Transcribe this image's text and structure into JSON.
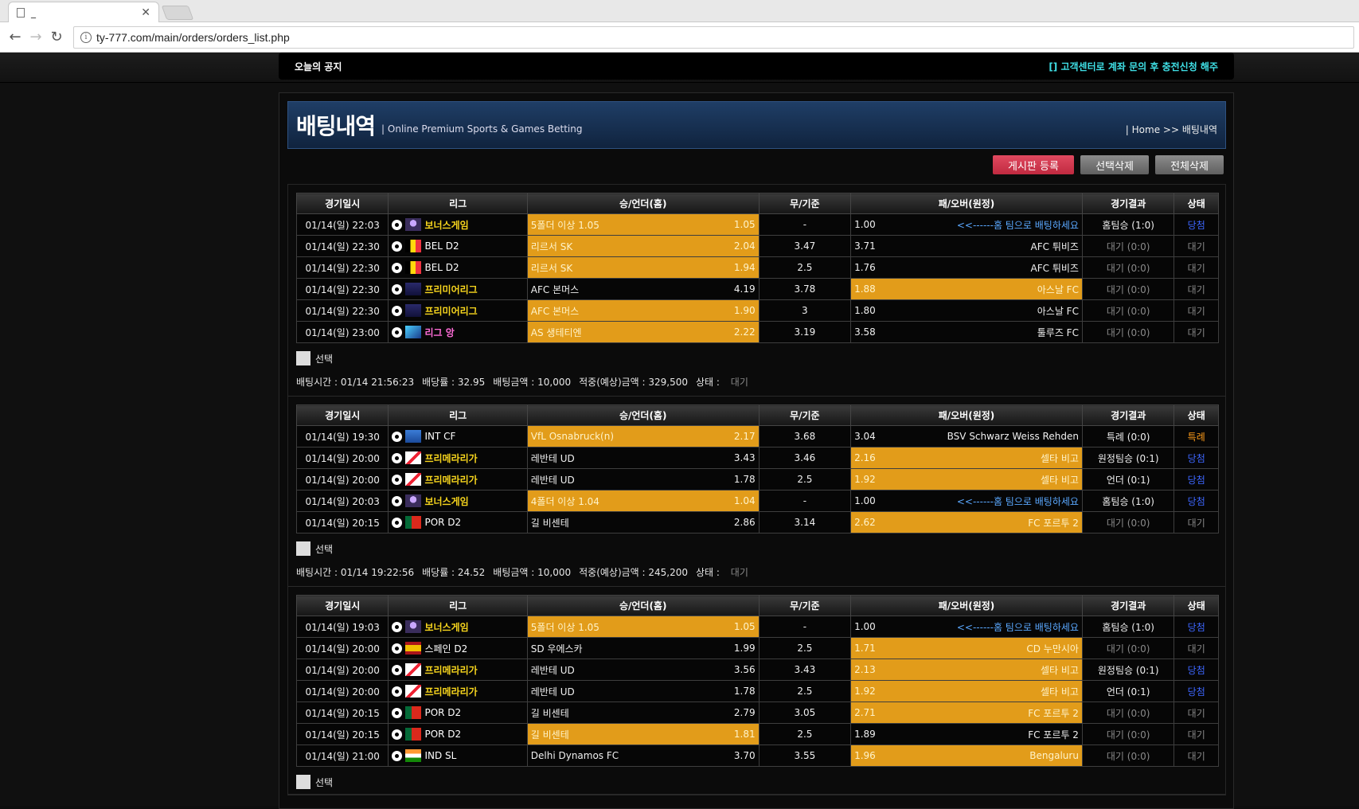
{
  "browser": {
    "tab_title": "_",
    "url": "ty-777.com/main/orders/orders_list.php"
  },
  "notice": {
    "label": "오늘의 공지",
    "text": "[] 고객센터로 계좌 문의 후 충전신청 해주"
  },
  "header": {
    "title": "배팅내역",
    "subtitle": "| Online Premium Sports & Games Betting",
    "breadcrumb": "| Home >> 배팅내역"
  },
  "buttons": {
    "register": "게시판 등록",
    "delete_selected": "선택삭제",
    "delete_all": "전체삭제"
  },
  "columns": [
    "경기일시",
    "리그",
    "승/언더(홈)",
    "무/기준",
    "패/오버(원정)",
    "경기결과",
    "상태"
  ],
  "select_label": "선택",
  "blocks": [
    {
      "rows": [
        {
          "date": "01/14(일) 22:03",
          "league": "보너스게임",
          "lstyle": "yellow",
          "flag": "bonus",
          "home": "5폴더 이상 1.05",
          "hodd": "1.05",
          "draw": "-",
          "aodd": "1.00",
          "away": "<<------홈 팀으로 배팅하세요",
          "awayBlue": true,
          "pick": "home",
          "result": "홈팀승 (1:0)",
          "status": "당첨",
          "sstyle": "blue"
        },
        {
          "date": "01/14(일) 22:30",
          "league": "BEL D2",
          "lstyle": "white",
          "flag": "bel",
          "home": "리르서 SK",
          "hodd": "2.04",
          "draw": "3.47",
          "aodd": "3.71",
          "away": "AFC 튀비즈",
          "pick": "home",
          "result": "대기 (0:0)",
          "status": "대기",
          "sstyle": "gray"
        },
        {
          "date": "01/14(일) 22:30",
          "league": "BEL D2",
          "lstyle": "white",
          "flag": "bel",
          "home": "리르서 SK",
          "hodd": "1.94",
          "draw": "2.5",
          "aodd": "1.76",
          "away": "AFC 튀비즈",
          "pick": "home",
          "result": "대기 (0:0)",
          "status": "대기",
          "sstyle": "gray"
        },
        {
          "date": "01/14(일) 22:30",
          "league": "프리미어리그",
          "lstyle": "yellow",
          "flag": "epl",
          "home": "AFC 본머스",
          "hodd": "4.19",
          "draw": "3.78",
          "aodd": "1.88",
          "away": "아스날 FC",
          "pick": "away",
          "result": "대기 (0:0)",
          "status": "대기",
          "sstyle": "gray"
        },
        {
          "date": "01/14(일) 22:30",
          "league": "프리미어리그",
          "lstyle": "yellow",
          "flag": "epl",
          "home": "AFC 본머스",
          "hodd": "1.90",
          "draw": "3",
          "aodd": "1.80",
          "away": "아스날 FC",
          "pick": "home",
          "result": "대기 (0:0)",
          "status": "대기",
          "sstyle": "gray"
        },
        {
          "date": "01/14(일) 23:00",
          "league": "리그 앙",
          "lstyle": "pink",
          "flag": "l1",
          "home": "AS 생테티엔",
          "hodd": "2.22",
          "draw": "3.19",
          "aodd": "3.58",
          "away": "툴루즈 FC",
          "pick": "home",
          "result": "대기 (0:0)",
          "status": "대기",
          "sstyle": "gray"
        }
      ],
      "summary": {
        "time": "배팅시간 : 01/14 21:56:23",
        "rate": "배당률 : 32.95",
        "amount": "배팅금액 : 10,000",
        "expected": "적중(예상)금액 : 329,500",
        "status_label": "상태 :",
        "status_value": "대기"
      }
    },
    {
      "rows": [
        {
          "date": "01/14(일) 19:30",
          "league": "INT CF",
          "lstyle": "white",
          "flag": "fifa",
          "home": "VfL Osnabruck(n)",
          "hodd": "2.17",
          "draw": "3.68",
          "aodd": "3.04",
          "away": "BSV Schwarz Weiss Rehden",
          "pick": "home",
          "result": "특례 (0:0)",
          "status": "특례",
          "sstyle": "orange"
        },
        {
          "date": "01/14(일) 20:00",
          "league": "프리메라리가",
          "lstyle": "yellow",
          "flag": "liga",
          "home": "레반테 UD",
          "hodd": "3.43",
          "draw": "3.46",
          "aodd": "2.16",
          "away": "셀타 비고",
          "pick": "away",
          "result": "원정팀승 (0:1)",
          "status": "당첨",
          "sstyle": "blue"
        },
        {
          "date": "01/14(일) 20:00",
          "league": "프리메라리가",
          "lstyle": "yellow",
          "flag": "liga",
          "home": "레반테 UD",
          "hodd": "1.78",
          "draw": "2.5",
          "aodd": "1.92",
          "away": "셀타 비고",
          "pick": "away",
          "result": "언더 (0:1)",
          "status": "당첨",
          "sstyle": "blue"
        },
        {
          "date": "01/14(일) 20:03",
          "league": "보너스게임",
          "lstyle": "yellow",
          "flag": "bonus",
          "home": "4폴더 이상 1.04",
          "hodd": "1.04",
          "draw": "-",
          "aodd": "1.00",
          "away": "<<------홈 팀으로 배팅하세요",
          "awayBlue": true,
          "pick": "home",
          "result": "홈팀승 (1:0)",
          "status": "당첨",
          "sstyle": "blue"
        },
        {
          "date": "01/14(일) 20:15",
          "league": "POR D2",
          "lstyle": "white",
          "flag": "por",
          "home": "길 비센테",
          "hodd": "2.86",
          "draw": "3.14",
          "aodd": "2.62",
          "away": "FC 포르투 2",
          "pick": "away",
          "result": "대기 (0:0)",
          "status": "대기",
          "sstyle": "gray"
        }
      ],
      "summary": {
        "time": "배팅시간 : 01/14 19:22:56",
        "rate": "배당률 : 24.52",
        "amount": "배팅금액 : 10,000",
        "expected": "적중(예상)금액 : 245,200",
        "status_label": "상태 :",
        "status_value": "대기"
      }
    },
    {
      "rows": [
        {
          "date": "01/14(일) 19:03",
          "league": "보너스게임",
          "lstyle": "yellow",
          "flag": "bonus",
          "home": "5폴더 이상 1.05",
          "hodd": "1.05",
          "draw": "-",
          "aodd": "1.00",
          "away": "<<------홈 팀으로 배팅하세요",
          "awayBlue": true,
          "pick": "home",
          "result": "홈팀승 (1:0)",
          "status": "당첨",
          "sstyle": "blue"
        },
        {
          "date": "01/14(일) 20:00",
          "league": "스페인 D2",
          "lstyle": "white",
          "flag": "esp",
          "home": "SD 우에스카",
          "hodd": "1.99",
          "draw": "2.5",
          "aodd": "1.71",
          "away": "CD 누만시아",
          "pick": "away",
          "result": "대기 (0:0)",
          "status": "대기",
          "sstyle": "gray"
        },
        {
          "date": "01/14(일) 20:00",
          "league": "프리메라리가",
          "lstyle": "yellow",
          "flag": "liga",
          "home": "레반테 UD",
          "hodd": "3.56",
          "draw": "3.43",
          "aodd": "2.13",
          "away": "셀타 비고",
          "pick": "away",
          "result": "원정팀승 (0:1)",
          "status": "당첨",
          "sstyle": "blue"
        },
        {
          "date": "01/14(일) 20:00",
          "league": "프리메라리가",
          "lstyle": "yellow",
          "flag": "liga",
          "home": "레반테 UD",
          "hodd": "1.78",
          "draw": "2.5",
          "aodd": "1.92",
          "away": "셀타 비고",
          "pick": "away",
          "result": "언더 (0:1)",
          "status": "당첨",
          "sstyle": "blue"
        },
        {
          "date": "01/14(일) 20:15",
          "league": "POR D2",
          "lstyle": "white",
          "flag": "por",
          "home": "길 비센테",
          "hodd": "2.79",
          "draw": "3.05",
          "aodd": "2.71",
          "away": "FC 포르투 2",
          "pick": "away",
          "result": "대기 (0:0)",
          "status": "대기",
          "sstyle": "gray"
        },
        {
          "date": "01/14(일) 20:15",
          "league": "POR D2",
          "lstyle": "white",
          "flag": "por",
          "home": "길 비센테",
          "hodd": "1.81",
          "draw": "2.5",
          "aodd": "1.89",
          "away": "FC 포르투 2",
          "pick": "home",
          "result": "대기 (0:0)",
          "status": "대기",
          "sstyle": "gray"
        },
        {
          "date": "01/14(일) 21:00",
          "league": "IND SL",
          "lstyle": "white",
          "flag": "ind",
          "home": "Delhi Dynamos FC",
          "hodd": "3.70",
          "draw": "3.55",
          "aodd": "1.96",
          "away": "Bengaluru",
          "pick": "away",
          "result": "대기 (0:0)",
          "status": "대기",
          "sstyle": "gray"
        }
      ]
    }
  ]
}
